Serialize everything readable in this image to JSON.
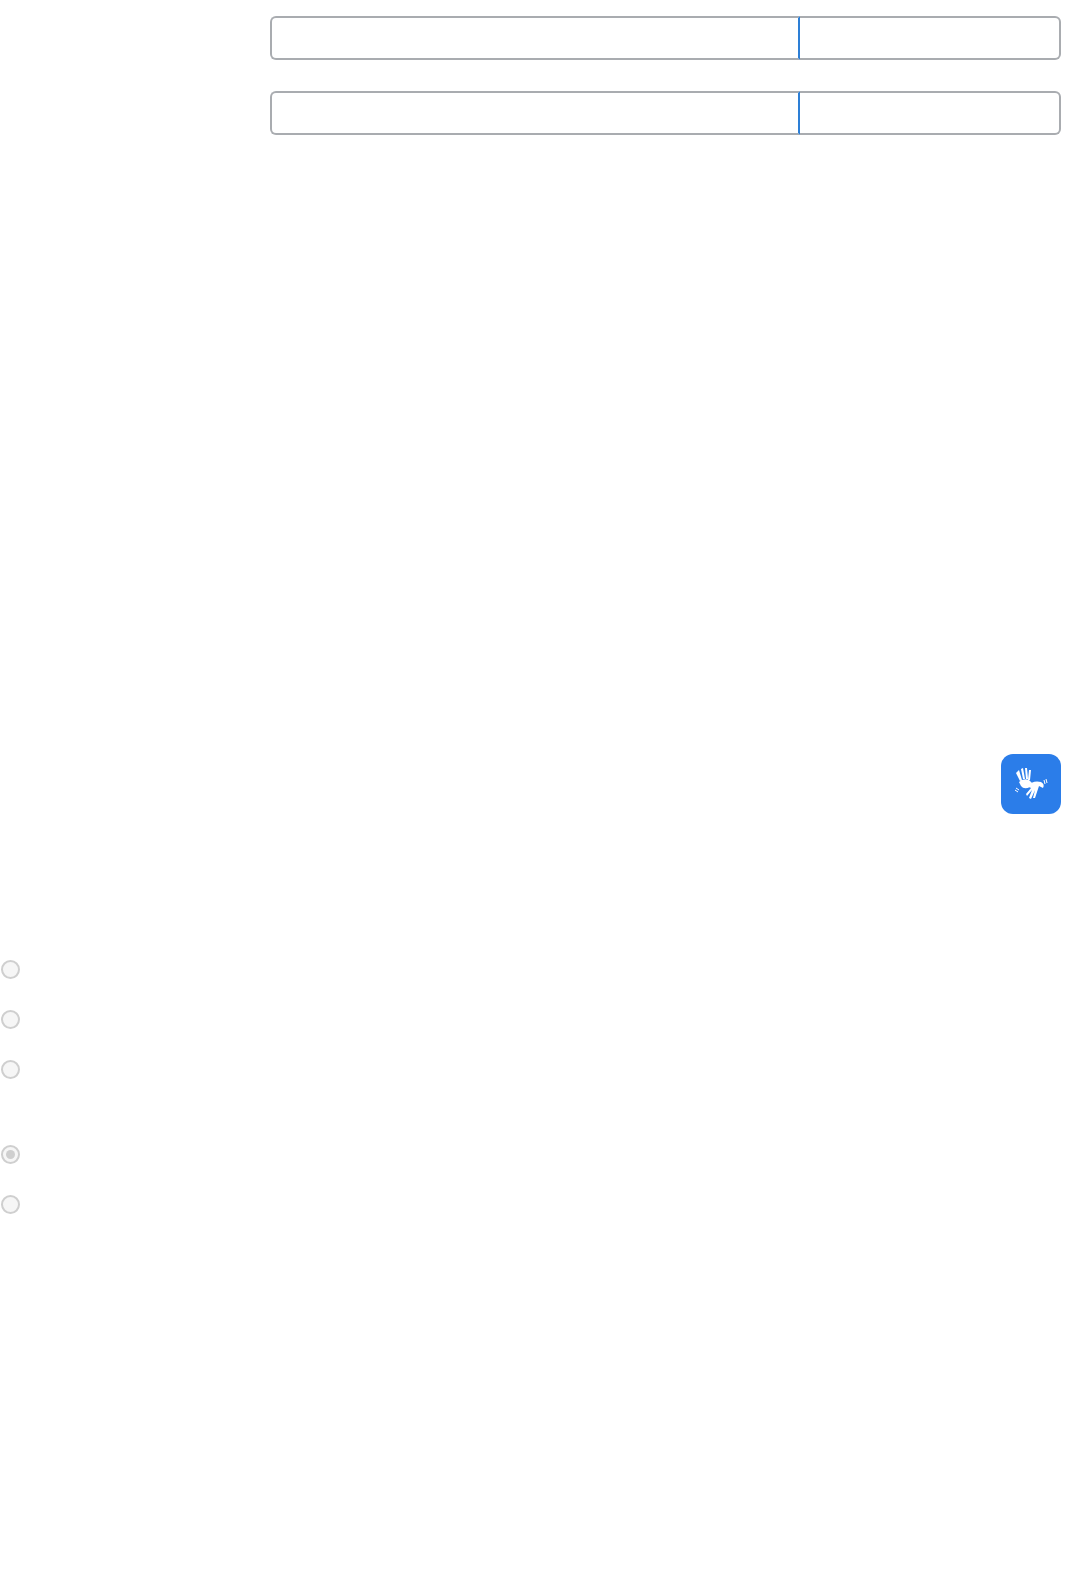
{
  "fields": [
    {
      "kind": "split"
    },
    {
      "kind": "split"
    }
  ],
  "radio_groups": [
    {
      "options": [
        {
          "selected": false
        },
        {
          "selected": false
        },
        {
          "selected": false
        }
      ]
    },
    {
      "options": [
        {
          "selected": true
        },
        {
          "selected": false
        }
      ]
    }
  ],
  "accessibility_button": {
    "kind": "sign-language"
  }
}
